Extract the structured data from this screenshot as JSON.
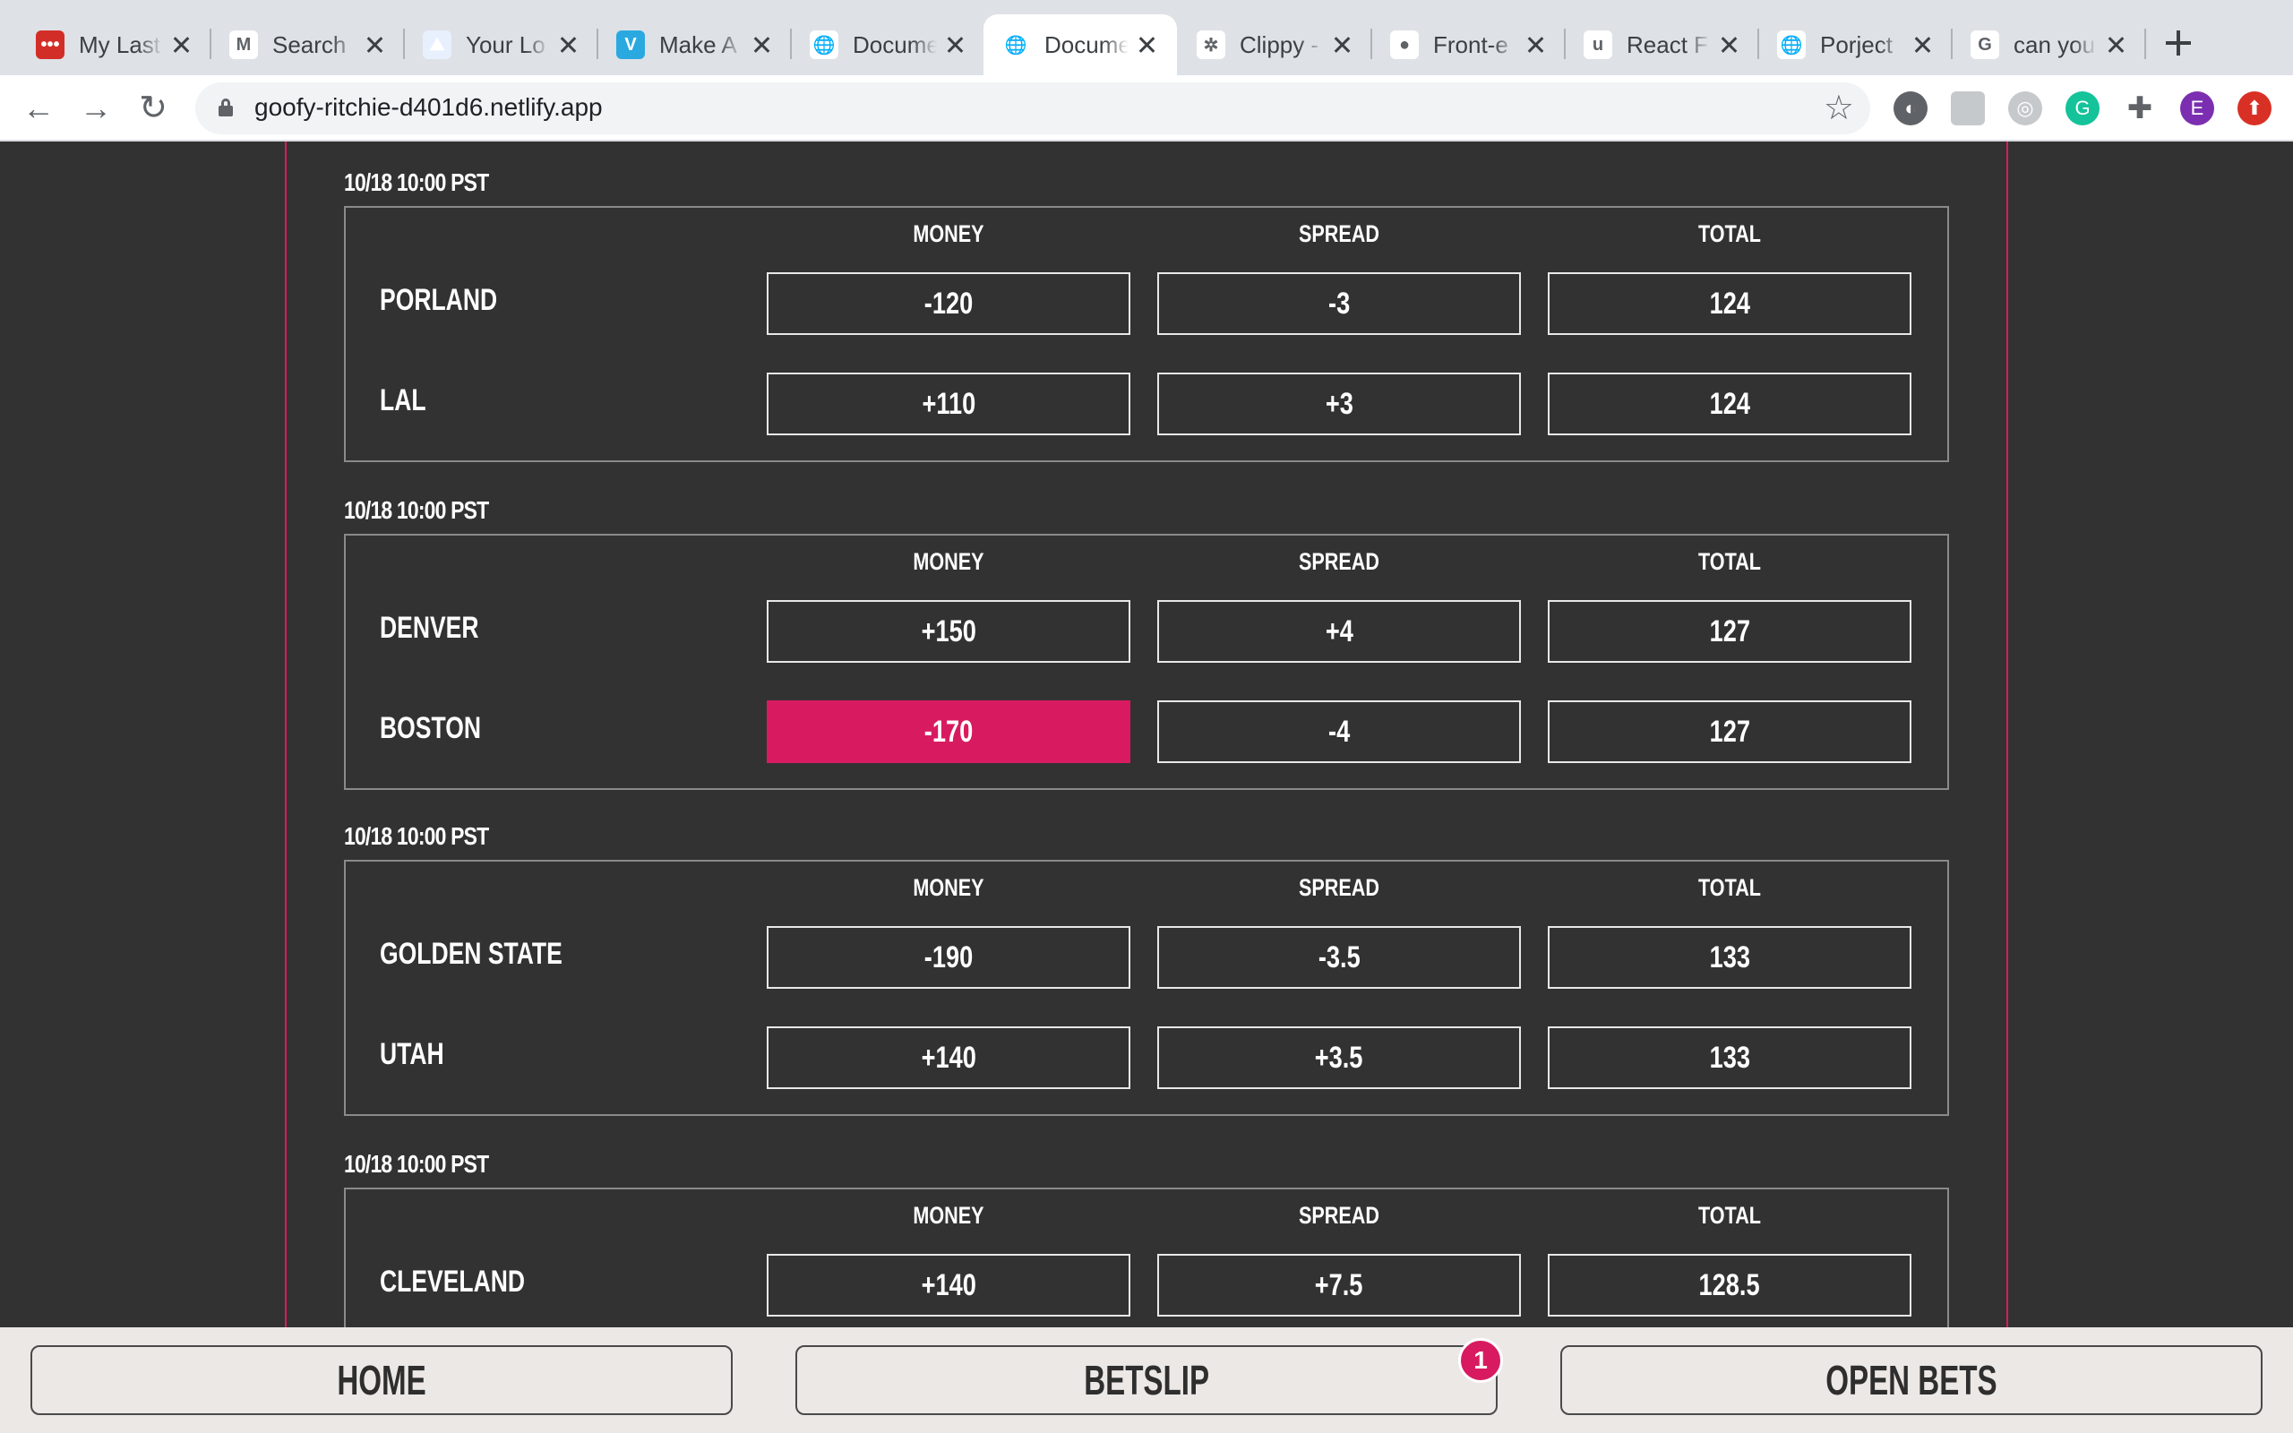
{
  "browser": {
    "tabs": [
      {
        "title": "My Last",
        "favicon": "lastpass-icon",
        "color": "#d32d27",
        "glyph": "•••"
      },
      {
        "title": "Search",
        "favicon": "gmail-icon",
        "color": "#ffffff",
        "glyph": "M"
      },
      {
        "title": "Your Lo",
        "favicon": "site-icon",
        "color": "#e8f0fe",
        "glyph": "⛰"
      },
      {
        "title": "Make A",
        "favicon": "figma-plugin-icon",
        "color": "#2aa9e0",
        "glyph": "V"
      },
      {
        "title": "Docume",
        "favicon": "globe-icon",
        "color": "#ffffff",
        "glyph": "🌐"
      },
      {
        "title": "Docume",
        "favicon": "globe-icon",
        "color": "#ffffff",
        "glyph": "🌐",
        "active": true
      },
      {
        "title": "Clippy -",
        "favicon": "clippy-icon",
        "color": "#ffffff",
        "glyph": "✲"
      },
      {
        "title": "Front-e",
        "favicon": "github-icon",
        "color": "#ffffff",
        "glyph": "●"
      },
      {
        "title": "React F",
        "favicon": "udemy-icon",
        "color": "#ffffff",
        "glyph": "u"
      },
      {
        "title": "Porject",
        "favicon": "globe-icon",
        "color": "#ffffff",
        "glyph": "🌐"
      },
      {
        "title": "can you",
        "favicon": "google-icon",
        "color": "#ffffff",
        "glyph": "G"
      }
    ],
    "url": "goofy-ritchie-d401d6.netlify.app",
    "profile_initial": "E"
  },
  "columns": {
    "money": "MONEY",
    "spread": "SPREAD",
    "total": "TOTAL"
  },
  "games": [
    {
      "time": "10/18 10:00 PST",
      "teams": [
        {
          "name": "PORLAND",
          "money": "-120",
          "spread": "-3",
          "total": "124"
        },
        {
          "name": "LAL",
          "money": "+110",
          "spread": "+3",
          "total": "124"
        }
      ]
    },
    {
      "time": "10/18 10:00 PST",
      "teams": [
        {
          "name": "DENVER",
          "money": "+150",
          "spread": "+4",
          "total": "127"
        },
        {
          "name": "BOSTON",
          "money": "-170",
          "spread": "-4",
          "total": "127"
        }
      ]
    },
    {
      "time": "10/18 10:00 PST",
      "teams": [
        {
          "name": "GOLDEN STATE",
          "money": "-190",
          "spread": "-3.5",
          "total": "133"
        },
        {
          "name": "UTAH",
          "money": "+140",
          "spread": "+3.5",
          "total": "133"
        }
      ]
    },
    {
      "time": "10/18 10:00 PST",
      "teams": [
        {
          "name": "CLEVELAND",
          "money": "+140",
          "spread": "+7.5",
          "total": "128.5"
        }
      ]
    }
  ],
  "selected_bet": {
    "game": 1,
    "team": 1,
    "market": "money"
  },
  "bottom_nav": {
    "home": "HOME",
    "betslip": "BETSLIP",
    "open_bets": "OPEN BETS",
    "betslip_count": "1"
  },
  "colors": {
    "accent": "#d81b60",
    "page_bg": "#323232"
  }
}
